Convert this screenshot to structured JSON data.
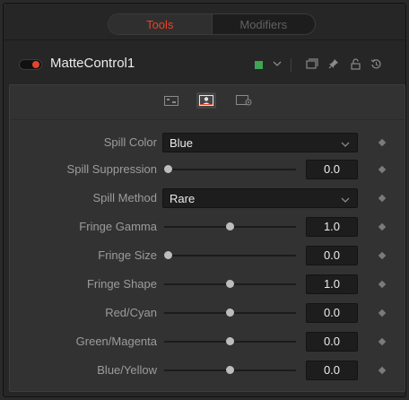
{
  "tabs": {
    "tools": "Tools",
    "modifiers": "Modifiers"
  },
  "node": {
    "name": "MatteControl1",
    "color": "#3fa554"
  },
  "icons": {
    "toggle": "power-toggle-icon",
    "color_dropdown": "chevron-down-icon",
    "versions": "versions-icon",
    "pin": "pin-icon",
    "lock": "lock-icon",
    "reset": "reset-icon",
    "subtabs": [
      "image-tab-icon",
      "matte-tab-icon",
      "settings-tab-icon"
    ]
  },
  "controls": {
    "spill_color": {
      "label": "Spill Color",
      "value": "Blue"
    },
    "spill_suppression": {
      "label": "Spill Suppression",
      "value": "0.0",
      "level": 0.0
    },
    "spill_method": {
      "label": "Spill Method",
      "value": "Rare"
    },
    "fringe_gamma": {
      "label": "Fringe Gamma",
      "value": "1.0",
      "level": 0.5
    },
    "fringe_size": {
      "label": "Fringe Size",
      "value": "0.0",
      "level": 0.0
    },
    "fringe_shape": {
      "label": "Fringe Shape",
      "value": "1.0",
      "level": 0.5
    },
    "red_cyan": {
      "label": "Red/Cyan",
      "value": "0.0",
      "level": 0.5
    },
    "green_magenta": {
      "label": "Green/Magenta",
      "value": "0.0",
      "level": 0.5
    },
    "blue_yellow": {
      "label": "Blue/Yellow",
      "value": "0.0",
      "level": 0.5
    }
  }
}
